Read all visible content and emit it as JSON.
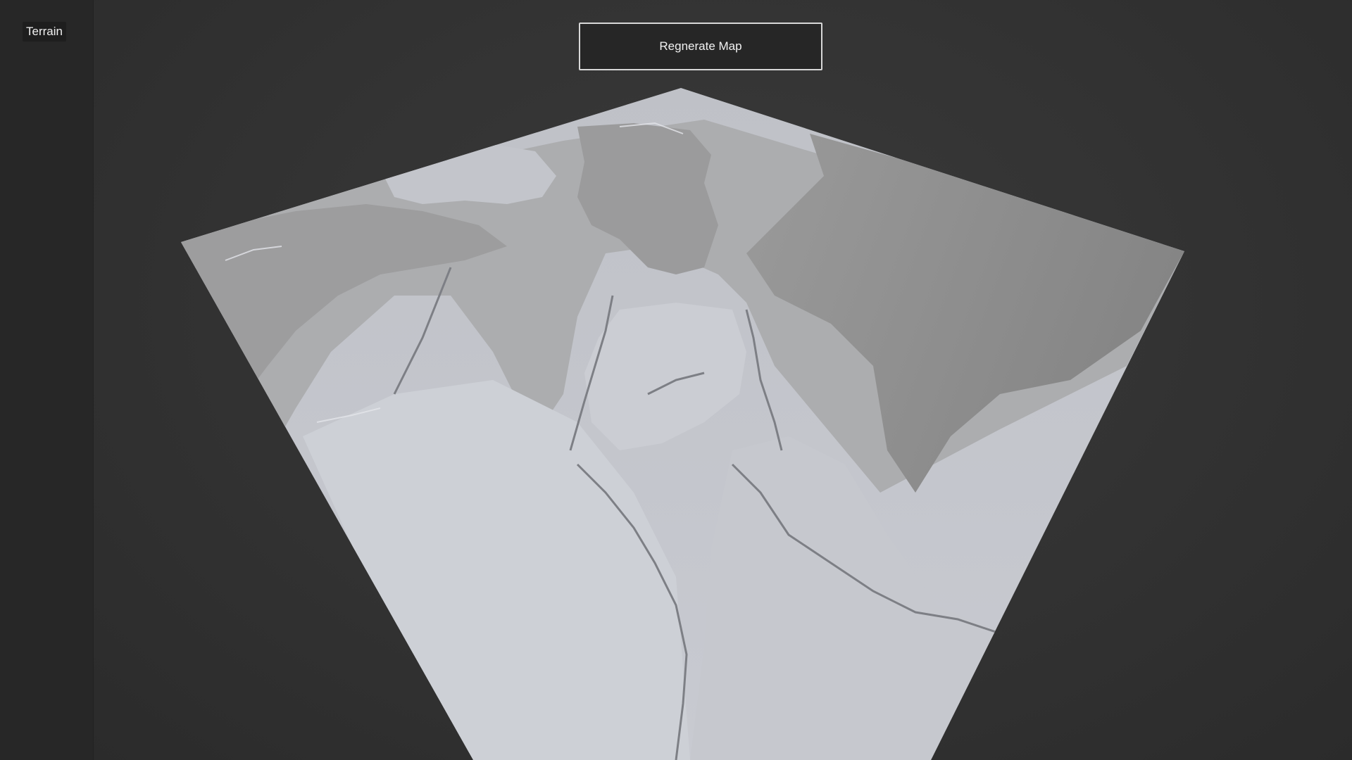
{
  "sidebar": {
    "items": [
      {
        "label": "Terrain"
      }
    ]
  },
  "toolbar": {
    "regenerate_label": "Regnerate Map"
  },
  "colors": {
    "background": "#2f2f2f",
    "sidebar_bg": "#272727",
    "button_bg": "#262626",
    "button_border": "#d8d8d8",
    "terrain_high": "#c9ccd3",
    "terrain_mid": "#aeaeae",
    "terrain_low": "#8f8f8f"
  }
}
